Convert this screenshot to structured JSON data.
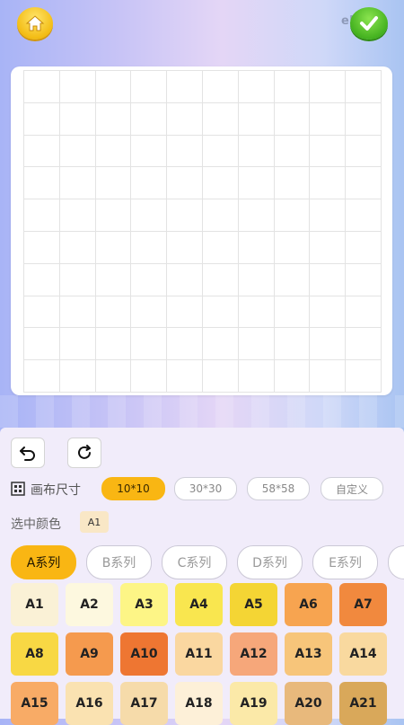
{
  "header": {
    "hash_text": "e59c8"
  },
  "toolbar": {
    "canvas_size_label": "画布尺寸",
    "sizes": [
      "10*10",
      "30*30",
      "58*58",
      "自定义"
    ],
    "selected_color_label": "选中颜色",
    "selected_color_value": "A1"
  },
  "series_tabs": [
    "A系列",
    "B系列",
    "C系列",
    "D系列",
    "E系列"
  ],
  "palette": [
    {
      "label": "A1",
      "color": "#faf1d6"
    },
    {
      "label": "A2",
      "color": "#fdf8df"
    },
    {
      "label": "A3",
      "color": "#fdf586"
    },
    {
      "label": "A4",
      "color": "#f9e64f"
    },
    {
      "label": "A5",
      "color": "#f4d534"
    },
    {
      "label": "A6",
      "color": "#f7a450"
    },
    {
      "label": "A7",
      "color": "#f1893e"
    },
    {
      "label": "A8",
      "color": "#f8d844"
    },
    {
      "label": "A9",
      "color": "#f59a4e"
    },
    {
      "label": "A10",
      "color": "#ee7632"
    },
    {
      "label": "A11",
      "color": "#fad7a0"
    },
    {
      "label": "A12",
      "color": "#f6a77a"
    },
    {
      "label": "A13",
      "color": "#f7c57a"
    },
    {
      "label": "A14",
      "color": "#f9d99f"
    },
    {
      "label": "A15",
      "color": "#f8ab66"
    },
    {
      "label": "A16",
      "color": "#fae2b1"
    },
    {
      "label": "A17",
      "color": "#f6dbaa"
    },
    {
      "label": "A18",
      "color": "#fdf0d8"
    },
    {
      "label": "A19",
      "color": "#fbe9a8"
    },
    {
      "label": "A20",
      "color": "#e8b97c"
    },
    {
      "label": "A21",
      "color": "#d9a85a"
    }
  ]
}
